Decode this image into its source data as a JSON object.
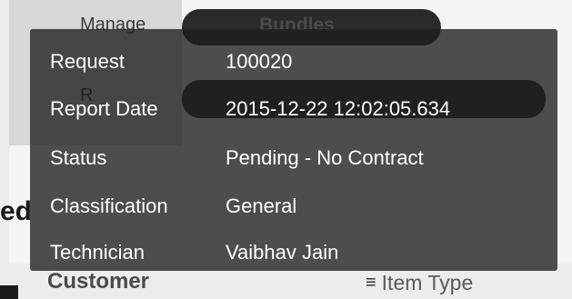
{
  "background": {
    "menu_item_manage": "Manage",
    "menu_pill_bundles": "Bundles",
    "ghost_letter": "R",
    "heading_fragment": "ed",
    "column_customer": "Customer",
    "column_item_type": "Item Type",
    "item_type_icon": "list-icon"
  },
  "tooltip": {
    "rows": [
      {
        "label": "Request",
        "value": "100020"
      },
      {
        "label": "Report Date",
        "value": "2015-12-22 12:02:05.634"
      },
      {
        "label": "Status",
        "value": "Pending - No Contract"
      },
      {
        "label": "Classification",
        "value": "General"
      },
      {
        "label": "Technician",
        "value": "Vaibhav Jain"
      }
    ]
  },
  "colors": {
    "tooltip_bg": "#1e1e1e",
    "tooltip_text": "#ffffff"
  }
}
